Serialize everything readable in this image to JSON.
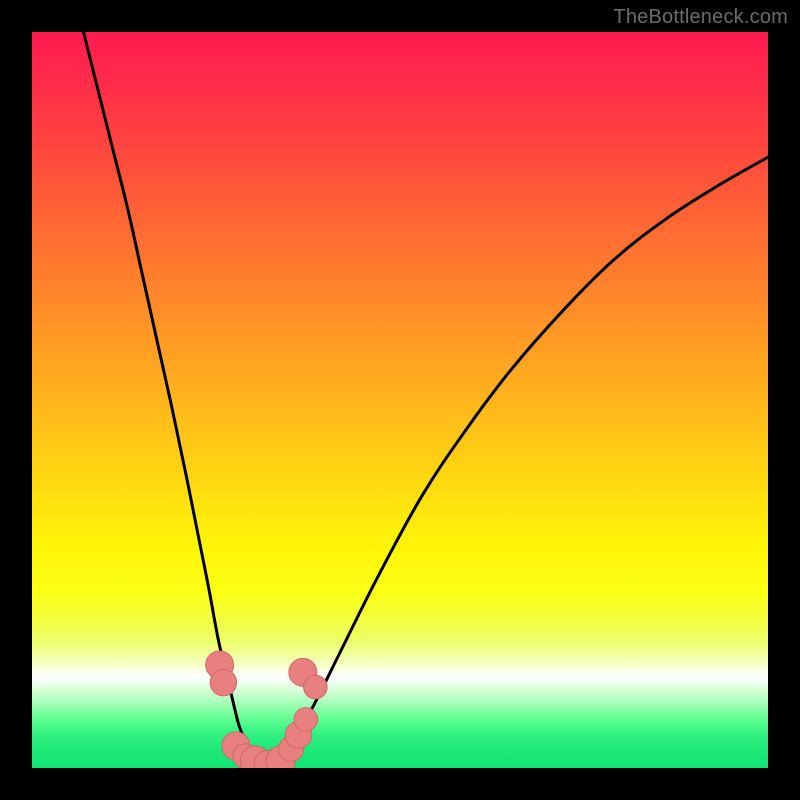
{
  "watermark": "TheBottleneck.com",
  "colors": {
    "background": "#000000",
    "curve": "#000000",
    "marker_fill": "#e98080",
    "marker_stroke": "#d06868",
    "gradient_top": "#ff1a4e",
    "gradient_bottom": "#10e472",
    "white_band": "#ffffff"
  },
  "chart_data": {
    "type": "line",
    "title": "",
    "xlabel": "",
    "ylabel": "",
    "xlim": [
      0,
      1
    ],
    "ylim": [
      0,
      1
    ],
    "grid": false,
    "legend": false,
    "series": [
      {
        "name": "left-curve",
        "x": [
          0.07,
          0.09,
          0.11,
          0.13,
          0.15,
          0.17,
          0.19,
          0.21,
          0.225,
          0.24,
          0.252,
          0.262,
          0.272,
          0.28,
          0.288,
          0.298,
          0.31
        ],
        "y": [
          1.0,
          0.92,
          0.84,
          0.76,
          0.67,
          0.58,
          0.49,
          0.395,
          0.32,
          0.245,
          0.18,
          0.135,
          0.095,
          0.062,
          0.04,
          0.018,
          0.006
        ]
      },
      {
        "name": "right-curve",
        "x": [
          0.33,
          0.35,
          0.38,
          0.42,
          0.47,
          0.53,
          0.59,
          0.65,
          0.72,
          0.79,
          0.86,
          0.93,
          1.0
        ],
        "y": [
          0.006,
          0.028,
          0.08,
          0.16,
          0.26,
          0.37,
          0.46,
          0.54,
          0.62,
          0.69,
          0.745,
          0.79,
          0.83
        ]
      }
    ],
    "markers": [
      {
        "x": 0.255,
        "y": 0.14,
        "r": 0.019
      },
      {
        "x": 0.26,
        "y": 0.116,
        "r": 0.018
      },
      {
        "x": 0.277,
        "y": 0.03,
        "r": 0.019
      },
      {
        "x": 0.29,
        "y": 0.016,
        "r": 0.017
      },
      {
        "x": 0.303,
        "y": 0.01,
        "r": 0.02
      },
      {
        "x": 0.32,
        "y": 0.006,
        "r": 0.018
      },
      {
        "x": 0.338,
        "y": 0.01,
        "r": 0.02
      },
      {
        "x": 0.352,
        "y": 0.026,
        "r": 0.017
      },
      {
        "x": 0.362,
        "y": 0.045,
        "r": 0.018
      },
      {
        "x": 0.372,
        "y": 0.066,
        "r": 0.016
      },
      {
        "x": 0.368,
        "y": 0.13,
        "r": 0.019
      },
      {
        "x": 0.385,
        "y": 0.11,
        "r": 0.016
      }
    ]
  }
}
